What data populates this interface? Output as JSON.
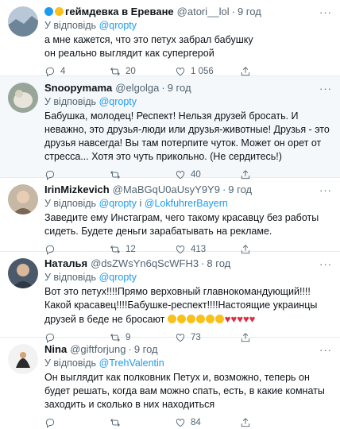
{
  "tweets": [
    {
      "name": "геймдевка в Ереване",
      "handle": "@atori__lol",
      "time": "9 год",
      "reply_prefix": "У відповідь",
      "reply_to": "@qropty",
      "reply_extra": "",
      "text": "а мне кажется, что это петух забрал бабушку\nон реально выглядит как супергерой",
      "replies": "4",
      "retweets": "20",
      "likes": "1 056",
      "name_prefix_hearts": [
        "#1d9bf0",
        "#f9c11b"
      ]
    },
    {
      "name": "Snoopymama",
      "handle": "@elgolga",
      "time": "9 год",
      "reply_prefix": "У відповідь",
      "reply_to": "@qropty",
      "reply_extra": "",
      "text": "Бабушка, молодец! Респект! Нельзя друзей бросать. И неважно, это друзья-люди или друзья-животные! Друзья - это друзья навсегда! Вы там потерпите чуток. Может он орет от стресса... Хотя это чуть прикольно. (Не сердитесь!)",
      "replies": "",
      "retweets": "",
      "likes": "40"
    },
    {
      "name": "IrinMizkevich",
      "handle": "@MaBGqU0aUsyY9Y9",
      "time": "9 год",
      "reply_prefix": "У відповідь",
      "reply_to": "@qropty",
      "reply_and": "і",
      "reply_extra": "@LokfuhrerBayern",
      "text": "Заведите ему Инстаграм, чего такому красавцу без работы сидеть. Будете деньги зарабатывать на рекламе.",
      "replies": "",
      "retweets": "12",
      "likes": "413"
    },
    {
      "name": "Наталья",
      "handle": "@dsZWsYn6qScWFH3",
      "time": "8 год",
      "reply_prefix": "У відповідь",
      "reply_to": "@qropty",
      "reply_extra": "",
      "text": "Вот это петух!!!!Прямо верховный главнокомандующий!!!!Какой красавец!!!!Бабушке-респект!!!!Настоящие украинцы друзей в беде не бросают",
      "emoji_count": 6,
      "heart_count": 5,
      "replies": "",
      "retweets": "9",
      "likes": "73"
    },
    {
      "name": "Nina",
      "handle": "@giftforjung",
      "time": "9 год",
      "reply_prefix": "У відповідь",
      "reply_to": "@TrehValentin",
      "reply_extra": "",
      "text": "Он выглядит как полковник Петух и, возможно, теперь он будет решать, когда вам можно спать, есть, в какие комнаты заходить и сколько в них находиться",
      "replies": "",
      "retweets": "",
      "likes": "84"
    }
  ],
  "icons": {
    "reply": "reply-icon",
    "retweet": "retweet-icon",
    "like": "heart-icon",
    "share": "share-icon",
    "more": "more-icon"
  },
  "more_label": "···",
  "colors": {
    "link": "#1d9bf0",
    "muted": "#536471",
    "highlight_bg": "#f5f8fa",
    "heart": "#dd2e44"
  }
}
